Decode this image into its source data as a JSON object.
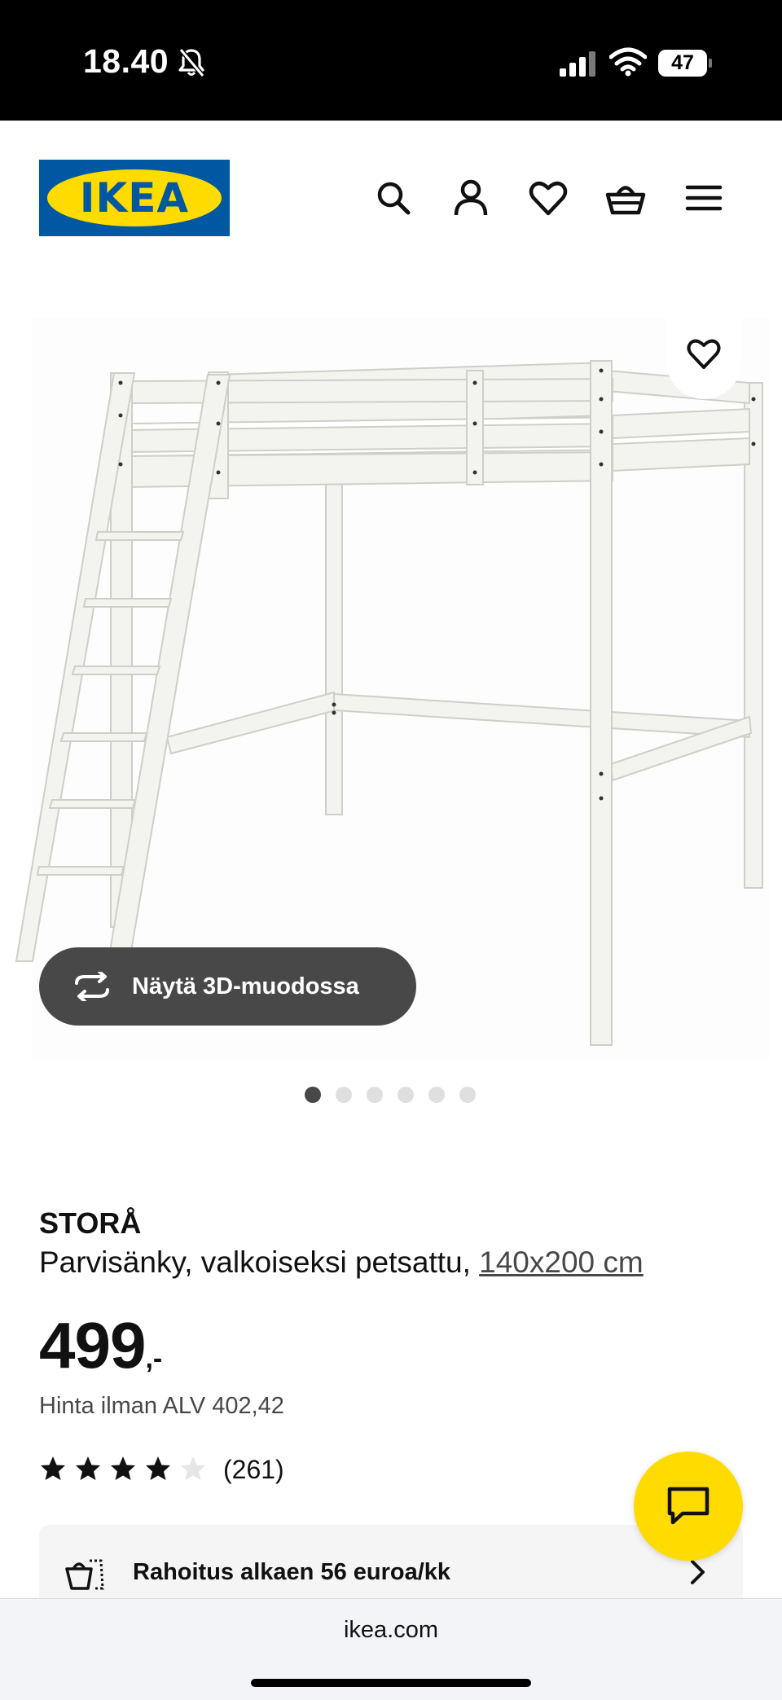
{
  "status_bar": {
    "time": "18.40",
    "battery": "47",
    "icons": [
      "bell-slash-icon",
      "signal-icon",
      "wifi-icon",
      "battery-icon"
    ]
  },
  "header": {
    "logo_text": "IKEA",
    "icons": [
      "search-icon",
      "account-icon",
      "heart-icon",
      "shopping-basket-icon",
      "menu-icon"
    ]
  },
  "gallery": {
    "view_3d_label": "Näytä 3D-muodossa",
    "image_count": 6,
    "active_image": 1
  },
  "product": {
    "name": "STORÅ",
    "description": "Parvisänky, valkoiseksi petsattu, ",
    "size": "140x200 cm",
    "price_integer": "499",
    "price_suffix": ",-",
    "price_vat": "Hinta ilman ALV 402,42",
    "rating_value": 4,
    "rating_max": 5,
    "rating_count": "(261)"
  },
  "financing": {
    "label": "Rahoitus alkaen 56 euroa/kk"
  },
  "browser": {
    "url": "ikea.com"
  },
  "colors": {
    "brand_blue": "#0058a3",
    "brand_yellow": "#ffdb00",
    "dark_pill": "#484848"
  }
}
